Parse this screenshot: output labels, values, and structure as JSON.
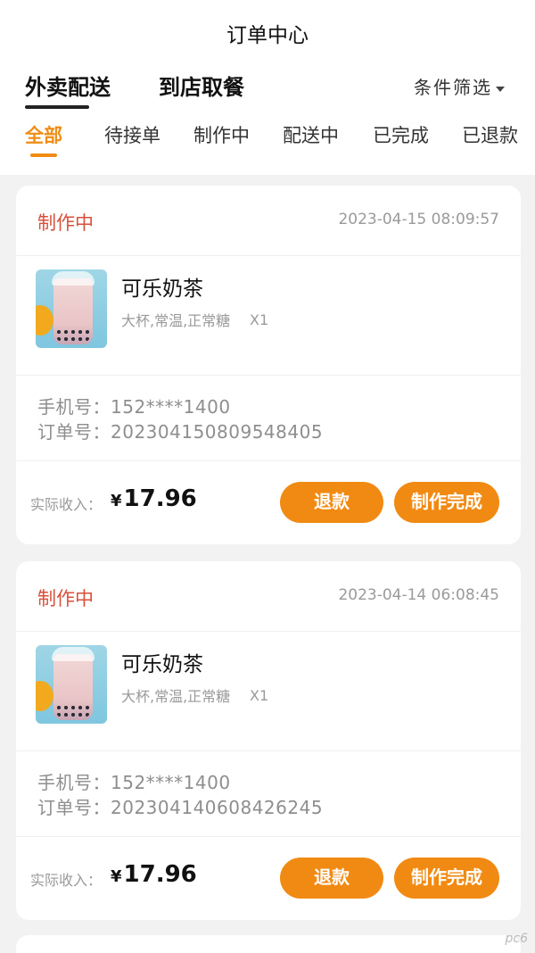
{
  "header": {
    "title": "订单中心",
    "main_tabs": [
      {
        "label": "外卖配送",
        "active": true
      },
      {
        "label": "到店取餐",
        "active": false
      }
    ],
    "filter_label": "条件筛选",
    "sub_tabs": [
      {
        "label": "全部",
        "active": true
      },
      {
        "label": "待接单",
        "active": false
      },
      {
        "label": "制作中",
        "active": false
      },
      {
        "label": "配送中",
        "active": false
      },
      {
        "label": "已完成",
        "active": false
      },
      {
        "label": "已退款",
        "active": false
      }
    ]
  },
  "colors": {
    "accent": "#f18a12",
    "status": "#d9503a",
    "background": "#f2f2f2"
  },
  "orders": [
    {
      "status": "制作中",
      "time": "2023-04-15 08:09:57",
      "product_name": "可乐奶茶",
      "product_spec": "大杯,常温,正常糖",
      "product_qty": "X1",
      "phone_label": "手机号：",
      "phone": "152****1400",
      "order_label": "订单号：",
      "order_no": "20230415080954840​5",
      "income_label": "实际收入：",
      "currency": "¥",
      "income": "17.96",
      "refund_label": "退款",
      "done_label": "制作完成"
    },
    {
      "status": "制作中",
      "time": "2023-04-14 06:08:45",
      "product_name": "可乐奶茶",
      "product_spec": "大杯,常温,正常糖",
      "product_qty": "X1",
      "phone_label": "手机号：",
      "phone": "152****1400",
      "order_label": "订单号：",
      "order_no": "20230414060842624​5",
      "income_label": "实际收入：",
      "currency": "¥",
      "income": "17.96",
      "refund_label": "退款",
      "done_label": "制作完成"
    }
  ],
  "watermark": "pc6"
}
